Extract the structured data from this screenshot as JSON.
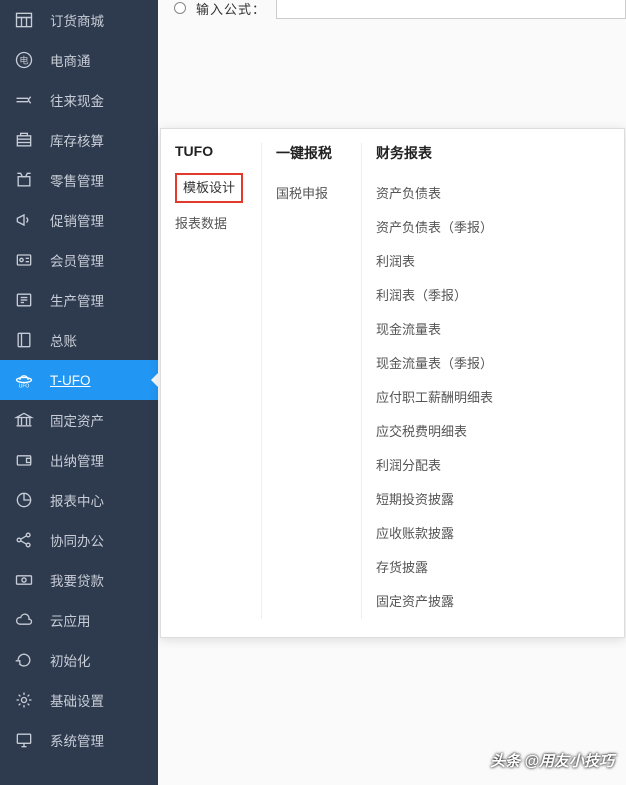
{
  "sidebar": {
    "items": [
      {
        "label": "订货商城",
        "icon": "store"
      },
      {
        "label": "电商通",
        "icon": "ecommerce"
      },
      {
        "label": "往来现金",
        "icon": "cash"
      },
      {
        "label": "库存核算",
        "icon": "inventory"
      },
      {
        "label": "零售管理",
        "icon": "retail"
      },
      {
        "label": "促销管理",
        "icon": "promo"
      },
      {
        "label": "会员管理",
        "icon": "member"
      },
      {
        "label": "生产管理",
        "icon": "production"
      },
      {
        "label": "总账",
        "icon": "ledger"
      },
      {
        "label": "T-UFO",
        "icon": "tufo",
        "active": true
      },
      {
        "label": "固定资产",
        "icon": "fixedasset"
      },
      {
        "label": "出纳管理",
        "icon": "cashier"
      },
      {
        "label": "报表中心",
        "icon": "reports"
      },
      {
        "label": "协同办公",
        "icon": "collab"
      },
      {
        "label": "我要贷款",
        "icon": "loan"
      },
      {
        "label": "云应用",
        "icon": "cloud"
      },
      {
        "label": "初始化",
        "icon": "init"
      },
      {
        "label": "基础设置",
        "icon": "settings"
      },
      {
        "label": "系统管理",
        "icon": "system"
      }
    ]
  },
  "topbar": {
    "label": "输入公式："
  },
  "flyout": {
    "columns": [
      {
        "title": "TUFO",
        "items": [
          {
            "label": "模板设计",
            "highlighted": true
          },
          {
            "label": "报表数据"
          }
        ]
      },
      {
        "title": "一键报税",
        "items": [
          {
            "label": "国税申报"
          }
        ]
      },
      {
        "title": "财务报表",
        "items": [
          {
            "label": "资产负债表"
          },
          {
            "label": "资产负债表（季报）"
          },
          {
            "label": "利润表"
          },
          {
            "label": "利润表（季报）"
          },
          {
            "label": "现金流量表"
          },
          {
            "label": "现金流量表（季报）"
          },
          {
            "label": "应付职工薪酬明细表"
          },
          {
            "label": "应交税费明细表"
          },
          {
            "label": "利润分配表"
          },
          {
            "label": "短期投资披露"
          },
          {
            "label": "应收账款披露"
          },
          {
            "label": "存货披露"
          },
          {
            "label": "固定资产披露"
          }
        ]
      }
    ]
  },
  "watermark": "头条 @用友小技巧"
}
